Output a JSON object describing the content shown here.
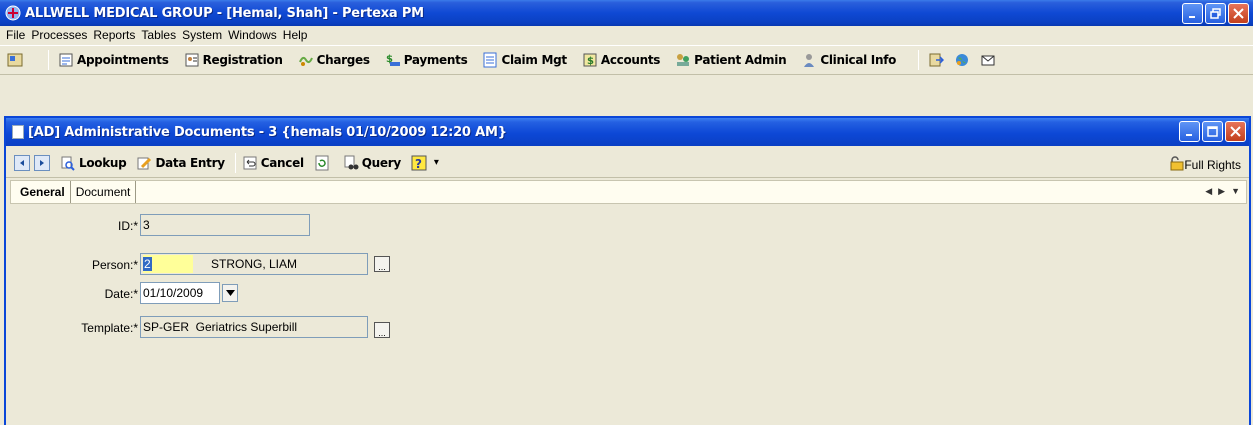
{
  "app": {
    "title": "ALLWELL MEDICAL GROUP - [Hemal, Shah] - Pertexa PM"
  },
  "menu": [
    "File",
    "Processes",
    "Reports",
    "Tables",
    "System",
    "Windows",
    "Help"
  ],
  "main_toolbar": {
    "appointments": "Appointments",
    "registration": "Registration",
    "charges": "Charges",
    "payments": "Payments",
    "claim_mgt": "Claim Mgt",
    "accounts": "Accounts",
    "patient_admin": "Patient Admin",
    "clinical_info": "Clinical Info"
  },
  "child_window": {
    "title": "[AD] Administrative Documents - 3 {hemals 01/10/2009 12:20 AM}",
    "toolbar": {
      "lookup": "Lookup",
      "data_entry": "Data Entry",
      "cancel": "Cancel",
      "query": "Query",
      "full_rights": "Full Rights"
    },
    "tabs": [
      "General",
      "Document"
    ],
    "form": {
      "id_label": "ID:*",
      "id_value": "3",
      "person_label": "Person:*",
      "person_id": "2",
      "person_name": "STRONG, LIAM",
      "date_label": "Date:*",
      "date_value": "01/10/2009",
      "template_label": "Template:*",
      "template_value": "SP-GER  Geriatrics Superbill"
    }
  },
  "colors": {
    "title_bar": "#0f49d4",
    "window_bg": "#ece9d8",
    "highlight": "#ffff99",
    "close_button": "#c23f1c"
  }
}
